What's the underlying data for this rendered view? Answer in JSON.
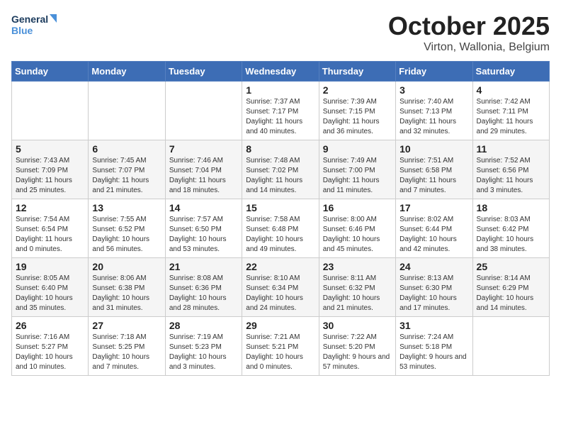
{
  "header": {
    "logo_line1": "General",
    "logo_line2": "Blue",
    "month_title": "October 2025",
    "location": "Virton, Wallonia, Belgium"
  },
  "weekdays": [
    "Sunday",
    "Monday",
    "Tuesday",
    "Wednesday",
    "Thursday",
    "Friday",
    "Saturday"
  ],
  "weeks": [
    [
      {
        "day": "",
        "sunrise": "",
        "sunset": "",
        "daylight": ""
      },
      {
        "day": "",
        "sunrise": "",
        "sunset": "",
        "daylight": ""
      },
      {
        "day": "",
        "sunrise": "",
        "sunset": "",
        "daylight": ""
      },
      {
        "day": "1",
        "sunrise": "Sunrise: 7:37 AM",
        "sunset": "Sunset: 7:17 PM",
        "daylight": "Daylight: 11 hours and 40 minutes."
      },
      {
        "day": "2",
        "sunrise": "Sunrise: 7:39 AM",
        "sunset": "Sunset: 7:15 PM",
        "daylight": "Daylight: 11 hours and 36 minutes."
      },
      {
        "day": "3",
        "sunrise": "Sunrise: 7:40 AM",
        "sunset": "Sunset: 7:13 PM",
        "daylight": "Daylight: 11 hours and 32 minutes."
      },
      {
        "day": "4",
        "sunrise": "Sunrise: 7:42 AM",
        "sunset": "Sunset: 7:11 PM",
        "daylight": "Daylight: 11 hours and 29 minutes."
      }
    ],
    [
      {
        "day": "5",
        "sunrise": "Sunrise: 7:43 AM",
        "sunset": "Sunset: 7:09 PM",
        "daylight": "Daylight: 11 hours and 25 minutes."
      },
      {
        "day": "6",
        "sunrise": "Sunrise: 7:45 AM",
        "sunset": "Sunset: 7:07 PM",
        "daylight": "Daylight: 11 hours and 21 minutes."
      },
      {
        "day": "7",
        "sunrise": "Sunrise: 7:46 AM",
        "sunset": "Sunset: 7:04 PM",
        "daylight": "Daylight: 11 hours and 18 minutes."
      },
      {
        "day": "8",
        "sunrise": "Sunrise: 7:48 AM",
        "sunset": "Sunset: 7:02 PM",
        "daylight": "Daylight: 11 hours and 14 minutes."
      },
      {
        "day": "9",
        "sunrise": "Sunrise: 7:49 AM",
        "sunset": "Sunset: 7:00 PM",
        "daylight": "Daylight: 11 hours and 11 minutes."
      },
      {
        "day": "10",
        "sunrise": "Sunrise: 7:51 AM",
        "sunset": "Sunset: 6:58 PM",
        "daylight": "Daylight: 11 hours and 7 minutes."
      },
      {
        "day": "11",
        "sunrise": "Sunrise: 7:52 AM",
        "sunset": "Sunset: 6:56 PM",
        "daylight": "Daylight: 11 hours and 3 minutes."
      }
    ],
    [
      {
        "day": "12",
        "sunrise": "Sunrise: 7:54 AM",
        "sunset": "Sunset: 6:54 PM",
        "daylight": "Daylight: 11 hours and 0 minutes."
      },
      {
        "day": "13",
        "sunrise": "Sunrise: 7:55 AM",
        "sunset": "Sunset: 6:52 PM",
        "daylight": "Daylight: 10 hours and 56 minutes."
      },
      {
        "day": "14",
        "sunrise": "Sunrise: 7:57 AM",
        "sunset": "Sunset: 6:50 PM",
        "daylight": "Daylight: 10 hours and 53 minutes."
      },
      {
        "day": "15",
        "sunrise": "Sunrise: 7:58 AM",
        "sunset": "Sunset: 6:48 PM",
        "daylight": "Daylight: 10 hours and 49 minutes."
      },
      {
        "day": "16",
        "sunrise": "Sunrise: 8:00 AM",
        "sunset": "Sunset: 6:46 PM",
        "daylight": "Daylight: 10 hours and 45 minutes."
      },
      {
        "day": "17",
        "sunrise": "Sunrise: 8:02 AM",
        "sunset": "Sunset: 6:44 PM",
        "daylight": "Daylight: 10 hours and 42 minutes."
      },
      {
        "day": "18",
        "sunrise": "Sunrise: 8:03 AM",
        "sunset": "Sunset: 6:42 PM",
        "daylight": "Daylight: 10 hours and 38 minutes."
      }
    ],
    [
      {
        "day": "19",
        "sunrise": "Sunrise: 8:05 AM",
        "sunset": "Sunset: 6:40 PM",
        "daylight": "Daylight: 10 hours and 35 minutes."
      },
      {
        "day": "20",
        "sunrise": "Sunrise: 8:06 AM",
        "sunset": "Sunset: 6:38 PM",
        "daylight": "Daylight: 10 hours and 31 minutes."
      },
      {
        "day": "21",
        "sunrise": "Sunrise: 8:08 AM",
        "sunset": "Sunset: 6:36 PM",
        "daylight": "Daylight: 10 hours and 28 minutes."
      },
      {
        "day": "22",
        "sunrise": "Sunrise: 8:10 AM",
        "sunset": "Sunset: 6:34 PM",
        "daylight": "Daylight: 10 hours and 24 minutes."
      },
      {
        "day": "23",
        "sunrise": "Sunrise: 8:11 AM",
        "sunset": "Sunset: 6:32 PM",
        "daylight": "Daylight: 10 hours and 21 minutes."
      },
      {
        "day": "24",
        "sunrise": "Sunrise: 8:13 AM",
        "sunset": "Sunset: 6:30 PM",
        "daylight": "Daylight: 10 hours and 17 minutes."
      },
      {
        "day": "25",
        "sunrise": "Sunrise: 8:14 AM",
        "sunset": "Sunset: 6:29 PM",
        "daylight": "Daylight: 10 hours and 14 minutes."
      }
    ],
    [
      {
        "day": "26",
        "sunrise": "Sunrise: 7:16 AM",
        "sunset": "Sunset: 5:27 PM",
        "daylight": "Daylight: 10 hours and 10 minutes."
      },
      {
        "day": "27",
        "sunrise": "Sunrise: 7:18 AM",
        "sunset": "Sunset: 5:25 PM",
        "daylight": "Daylight: 10 hours and 7 minutes."
      },
      {
        "day": "28",
        "sunrise": "Sunrise: 7:19 AM",
        "sunset": "Sunset: 5:23 PM",
        "daylight": "Daylight: 10 hours and 3 minutes."
      },
      {
        "day": "29",
        "sunrise": "Sunrise: 7:21 AM",
        "sunset": "Sunset: 5:21 PM",
        "daylight": "Daylight: 10 hours and 0 minutes."
      },
      {
        "day": "30",
        "sunrise": "Sunrise: 7:22 AM",
        "sunset": "Sunset: 5:20 PM",
        "daylight": "Daylight: 9 hours and 57 minutes."
      },
      {
        "day": "31",
        "sunrise": "Sunrise: 7:24 AM",
        "sunset": "Sunset: 5:18 PM",
        "daylight": "Daylight: 9 hours and 53 minutes."
      },
      {
        "day": "",
        "sunrise": "",
        "sunset": "",
        "daylight": ""
      }
    ]
  ]
}
